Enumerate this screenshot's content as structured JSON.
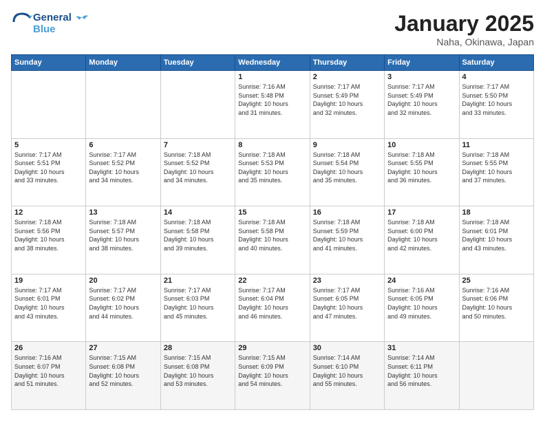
{
  "header": {
    "logo_line1": "General",
    "logo_line2": "Blue",
    "month": "January 2025",
    "location": "Naha, Okinawa, Japan"
  },
  "days_of_week": [
    "Sunday",
    "Monday",
    "Tuesday",
    "Wednesday",
    "Thursday",
    "Friday",
    "Saturday"
  ],
  "weeks": [
    [
      {
        "day": "",
        "info": ""
      },
      {
        "day": "",
        "info": ""
      },
      {
        "day": "",
        "info": ""
      },
      {
        "day": "1",
        "info": "Sunrise: 7:16 AM\nSunset: 5:48 PM\nDaylight: 10 hours\nand 31 minutes."
      },
      {
        "day": "2",
        "info": "Sunrise: 7:17 AM\nSunset: 5:49 PM\nDaylight: 10 hours\nand 32 minutes."
      },
      {
        "day": "3",
        "info": "Sunrise: 7:17 AM\nSunset: 5:49 PM\nDaylight: 10 hours\nand 32 minutes."
      },
      {
        "day": "4",
        "info": "Sunrise: 7:17 AM\nSunset: 5:50 PM\nDaylight: 10 hours\nand 33 minutes."
      }
    ],
    [
      {
        "day": "5",
        "info": "Sunrise: 7:17 AM\nSunset: 5:51 PM\nDaylight: 10 hours\nand 33 minutes."
      },
      {
        "day": "6",
        "info": "Sunrise: 7:17 AM\nSunset: 5:52 PM\nDaylight: 10 hours\nand 34 minutes."
      },
      {
        "day": "7",
        "info": "Sunrise: 7:18 AM\nSunset: 5:52 PM\nDaylight: 10 hours\nand 34 minutes."
      },
      {
        "day": "8",
        "info": "Sunrise: 7:18 AM\nSunset: 5:53 PM\nDaylight: 10 hours\nand 35 minutes."
      },
      {
        "day": "9",
        "info": "Sunrise: 7:18 AM\nSunset: 5:54 PM\nDaylight: 10 hours\nand 35 minutes."
      },
      {
        "day": "10",
        "info": "Sunrise: 7:18 AM\nSunset: 5:55 PM\nDaylight: 10 hours\nand 36 minutes."
      },
      {
        "day": "11",
        "info": "Sunrise: 7:18 AM\nSunset: 5:55 PM\nDaylight: 10 hours\nand 37 minutes."
      }
    ],
    [
      {
        "day": "12",
        "info": "Sunrise: 7:18 AM\nSunset: 5:56 PM\nDaylight: 10 hours\nand 38 minutes."
      },
      {
        "day": "13",
        "info": "Sunrise: 7:18 AM\nSunset: 5:57 PM\nDaylight: 10 hours\nand 38 minutes."
      },
      {
        "day": "14",
        "info": "Sunrise: 7:18 AM\nSunset: 5:58 PM\nDaylight: 10 hours\nand 39 minutes."
      },
      {
        "day": "15",
        "info": "Sunrise: 7:18 AM\nSunset: 5:58 PM\nDaylight: 10 hours\nand 40 minutes."
      },
      {
        "day": "16",
        "info": "Sunrise: 7:18 AM\nSunset: 5:59 PM\nDaylight: 10 hours\nand 41 minutes."
      },
      {
        "day": "17",
        "info": "Sunrise: 7:18 AM\nSunset: 6:00 PM\nDaylight: 10 hours\nand 42 minutes."
      },
      {
        "day": "18",
        "info": "Sunrise: 7:18 AM\nSunset: 6:01 PM\nDaylight: 10 hours\nand 43 minutes."
      }
    ],
    [
      {
        "day": "19",
        "info": "Sunrise: 7:17 AM\nSunset: 6:01 PM\nDaylight: 10 hours\nand 43 minutes."
      },
      {
        "day": "20",
        "info": "Sunrise: 7:17 AM\nSunset: 6:02 PM\nDaylight: 10 hours\nand 44 minutes."
      },
      {
        "day": "21",
        "info": "Sunrise: 7:17 AM\nSunset: 6:03 PM\nDaylight: 10 hours\nand 45 minutes."
      },
      {
        "day": "22",
        "info": "Sunrise: 7:17 AM\nSunset: 6:04 PM\nDaylight: 10 hours\nand 46 minutes."
      },
      {
        "day": "23",
        "info": "Sunrise: 7:17 AM\nSunset: 6:05 PM\nDaylight: 10 hours\nand 47 minutes."
      },
      {
        "day": "24",
        "info": "Sunrise: 7:16 AM\nSunset: 6:05 PM\nDaylight: 10 hours\nand 49 minutes."
      },
      {
        "day": "25",
        "info": "Sunrise: 7:16 AM\nSunset: 6:06 PM\nDaylight: 10 hours\nand 50 minutes."
      }
    ],
    [
      {
        "day": "26",
        "info": "Sunrise: 7:16 AM\nSunset: 6:07 PM\nDaylight: 10 hours\nand 51 minutes."
      },
      {
        "day": "27",
        "info": "Sunrise: 7:15 AM\nSunset: 6:08 PM\nDaylight: 10 hours\nand 52 minutes."
      },
      {
        "day": "28",
        "info": "Sunrise: 7:15 AM\nSunset: 6:08 PM\nDaylight: 10 hours\nand 53 minutes."
      },
      {
        "day": "29",
        "info": "Sunrise: 7:15 AM\nSunset: 6:09 PM\nDaylight: 10 hours\nand 54 minutes."
      },
      {
        "day": "30",
        "info": "Sunrise: 7:14 AM\nSunset: 6:10 PM\nDaylight: 10 hours\nand 55 minutes."
      },
      {
        "day": "31",
        "info": "Sunrise: 7:14 AM\nSunset: 6:11 PM\nDaylight: 10 hours\nand 56 minutes."
      },
      {
        "day": "",
        "info": ""
      }
    ]
  ]
}
